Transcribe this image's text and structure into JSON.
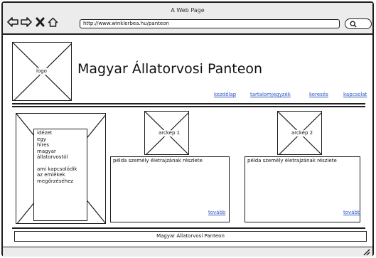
{
  "window": {
    "title": "A Web Page"
  },
  "browser": {
    "url": "http://www.winklerbea.hu/panteon",
    "nav_icons": [
      "back-arrow-icon",
      "forward-arrow-icon",
      "close-icon",
      "home-icon"
    ],
    "search_icon": "search-icon"
  },
  "header": {
    "logo_label": "logo",
    "title": "Magyar Állatorvosi Panteon",
    "nav": [
      {
        "label": "kezdőlap"
      },
      {
        "label": "tartalomjegyzék"
      },
      {
        "label": "keresés"
      },
      {
        "label": "kapcsolat"
      }
    ]
  },
  "sidebar": {
    "quote_lines": [
      "idézet",
      "egy",
      "híres",
      "magyar",
      "állatorvostól"
    ],
    "memory_lines": [
      "ami kapcsolódik",
      "az emlékek",
      "megőrzéséhez"
    ]
  },
  "cards": [
    {
      "image_label": "arckép 1",
      "text": "példa személy életrajzának részlete",
      "more_label": "tovább"
    },
    {
      "image_label": "arckép 2",
      "text": "példa személy életrajzának részlete",
      "more_label": "tovább"
    }
  ],
  "footer": {
    "text": "Magyar Állatorvosi Panteon"
  },
  "colors": {
    "link": "#2b55c7",
    "chrome": "#ececec",
    "stroke": "#1e1e1e"
  }
}
